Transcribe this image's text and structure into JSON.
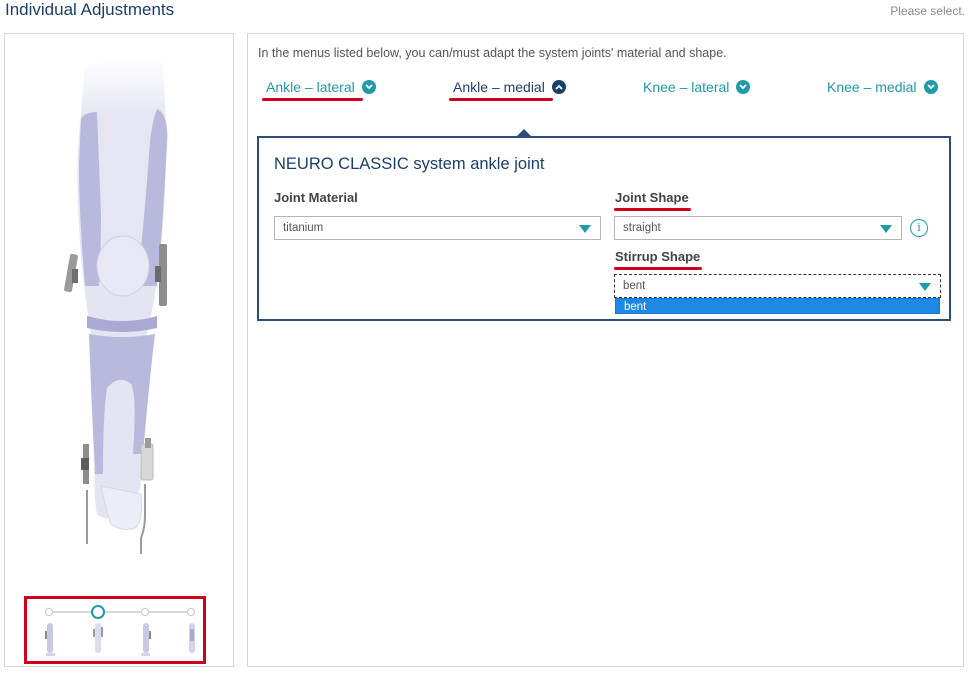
{
  "header": {
    "title": "Individual Adjustments",
    "hint": "Please select."
  },
  "intro": "In the menus listed below, you can/must adapt the system joints' material and shape.",
  "tabs": [
    {
      "label": "Ankle – lateral",
      "state": "collapsed"
    },
    {
      "label": "Ankle – medial",
      "state": "expanded"
    },
    {
      "label": "Knee – lateral",
      "state": "collapsed"
    },
    {
      "label": "Knee – medial",
      "state": "collapsed"
    }
  ],
  "card": {
    "title": "NEURO CLASSIC system ankle joint",
    "joint_material": {
      "label": "Joint Material",
      "value": "titanium"
    },
    "joint_shape": {
      "label": "Joint Shape",
      "value": "straight"
    },
    "stirrup_shape": {
      "label": "Stirrup Shape",
      "value": "bent",
      "options": [
        "bent"
      ]
    }
  },
  "view_slider": {
    "positions": 4,
    "selected": 2
  },
  "colors": {
    "accent": "#1e9aa8",
    "navy": "#1b3f6b",
    "highlight": "#d0021b",
    "leg": "#c9c9e6"
  }
}
